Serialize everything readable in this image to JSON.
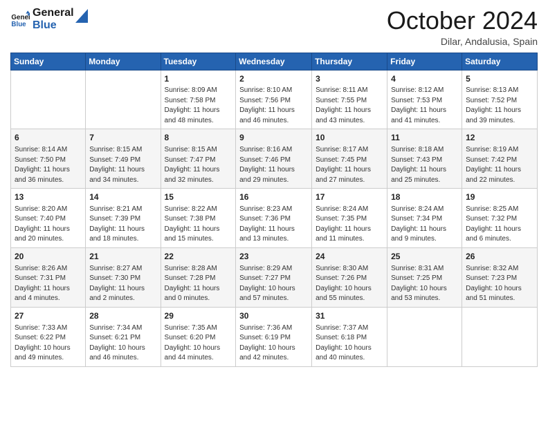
{
  "logo": {
    "line1": "General",
    "line2": "Blue"
  },
  "title": "October 2024",
  "location": "Dilar, Andalusia, Spain",
  "weekdays": [
    "Sunday",
    "Monday",
    "Tuesday",
    "Wednesday",
    "Thursday",
    "Friday",
    "Saturday"
  ],
  "weeks": [
    [
      {
        "day": "",
        "info": ""
      },
      {
        "day": "",
        "info": ""
      },
      {
        "day": "1",
        "info": "Sunrise: 8:09 AM\nSunset: 7:58 PM\nDaylight: 11 hours and 48 minutes."
      },
      {
        "day": "2",
        "info": "Sunrise: 8:10 AM\nSunset: 7:56 PM\nDaylight: 11 hours and 46 minutes."
      },
      {
        "day": "3",
        "info": "Sunrise: 8:11 AM\nSunset: 7:55 PM\nDaylight: 11 hours and 43 minutes."
      },
      {
        "day": "4",
        "info": "Sunrise: 8:12 AM\nSunset: 7:53 PM\nDaylight: 11 hours and 41 minutes."
      },
      {
        "day": "5",
        "info": "Sunrise: 8:13 AM\nSunset: 7:52 PM\nDaylight: 11 hours and 39 minutes."
      }
    ],
    [
      {
        "day": "6",
        "info": "Sunrise: 8:14 AM\nSunset: 7:50 PM\nDaylight: 11 hours and 36 minutes."
      },
      {
        "day": "7",
        "info": "Sunrise: 8:15 AM\nSunset: 7:49 PM\nDaylight: 11 hours and 34 minutes."
      },
      {
        "day": "8",
        "info": "Sunrise: 8:15 AM\nSunset: 7:47 PM\nDaylight: 11 hours and 32 minutes."
      },
      {
        "day": "9",
        "info": "Sunrise: 8:16 AM\nSunset: 7:46 PM\nDaylight: 11 hours and 29 minutes."
      },
      {
        "day": "10",
        "info": "Sunrise: 8:17 AM\nSunset: 7:45 PM\nDaylight: 11 hours and 27 minutes."
      },
      {
        "day": "11",
        "info": "Sunrise: 8:18 AM\nSunset: 7:43 PM\nDaylight: 11 hours and 25 minutes."
      },
      {
        "day": "12",
        "info": "Sunrise: 8:19 AM\nSunset: 7:42 PM\nDaylight: 11 hours and 22 minutes."
      }
    ],
    [
      {
        "day": "13",
        "info": "Sunrise: 8:20 AM\nSunset: 7:40 PM\nDaylight: 11 hours and 20 minutes."
      },
      {
        "day": "14",
        "info": "Sunrise: 8:21 AM\nSunset: 7:39 PM\nDaylight: 11 hours and 18 minutes."
      },
      {
        "day": "15",
        "info": "Sunrise: 8:22 AM\nSunset: 7:38 PM\nDaylight: 11 hours and 15 minutes."
      },
      {
        "day": "16",
        "info": "Sunrise: 8:23 AM\nSunset: 7:36 PM\nDaylight: 11 hours and 13 minutes."
      },
      {
        "day": "17",
        "info": "Sunrise: 8:24 AM\nSunset: 7:35 PM\nDaylight: 11 hours and 11 minutes."
      },
      {
        "day": "18",
        "info": "Sunrise: 8:24 AM\nSunset: 7:34 PM\nDaylight: 11 hours and 9 minutes."
      },
      {
        "day": "19",
        "info": "Sunrise: 8:25 AM\nSunset: 7:32 PM\nDaylight: 11 hours and 6 minutes."
      }
    ],
    [
      {
        "day": "20",
        "info": "Sunrise: 8:26 AM\nSunset: 7:31 PM\nDaylight: 11 hours and 4 minutes."
      },
      {
        "day": "21",
        "info": "Sunrise: 8:27 AM\nSunset: 7:30 PM\nDaylight: 11 hours and 2 minutes."
      },
      {
        "day": "22",
        "info": "Sunrise: 8:28 AM\nSunset: 7:28 PM\nDaylight: 11 hours and 0 minutes."
      },
      {
        "day": "23",
        "info": "Sunrise: 8:29 AM\nSunset: 7:27 PM\nDaylight: 10 hours and 57 minutes."
      },
      {
        "day": "24",
        "info": "Sunrise: 8:30 AM\nSunset: 7:26 PM\nDaylight: 10 hours and 55 minutes."
      },
      {
        "day": "25",
        "info": "Sunrise: 8:31 AM\nSunset: 7:25 PM\nDaylight: 10 hours and 53 minutes."
      },
      {
        "day": "26",
        "info": "Sunrise: 8:32 AM\nSunset: 7:23 PM\nDaylight: 10 hours and 51 minutes."
      }
    ],
    [
      {
        "day": "27",
        "info": "Sunrise: 7:33 AM\nSunset: 6:22 PM\nDaylight: 10 hours and 49 minutes."
      },
      {
        "day": "28",
        "info": "Sunrise: 7:34 AM\nSunset: 6:21 PM\nDaylight: 10 hours and 46 minutes."
      },
      {
        "day": "29",
        "info": "Sunrise: 7:35 AM\nSunset: 6:20 PM\nDaylight: 10 hours and 44 minutes."
      },
      {
        "day": "30",
        "info": "Sunrise: 7:36 AM\nSunset: 6:19 PM\nDaylight: 10 hours and 42 minutes."
      },
      {
        "day": "31",
        "info": "Sunrise: 7:37 AM\nSunset: 6:18 PM\nDaylight: 10 hours and 40 minutes."
      },
      {
        "day": "",
        "info": ""
      },
      {
        "day": "",
        "info": ""
      }
    ]
  ]
}
